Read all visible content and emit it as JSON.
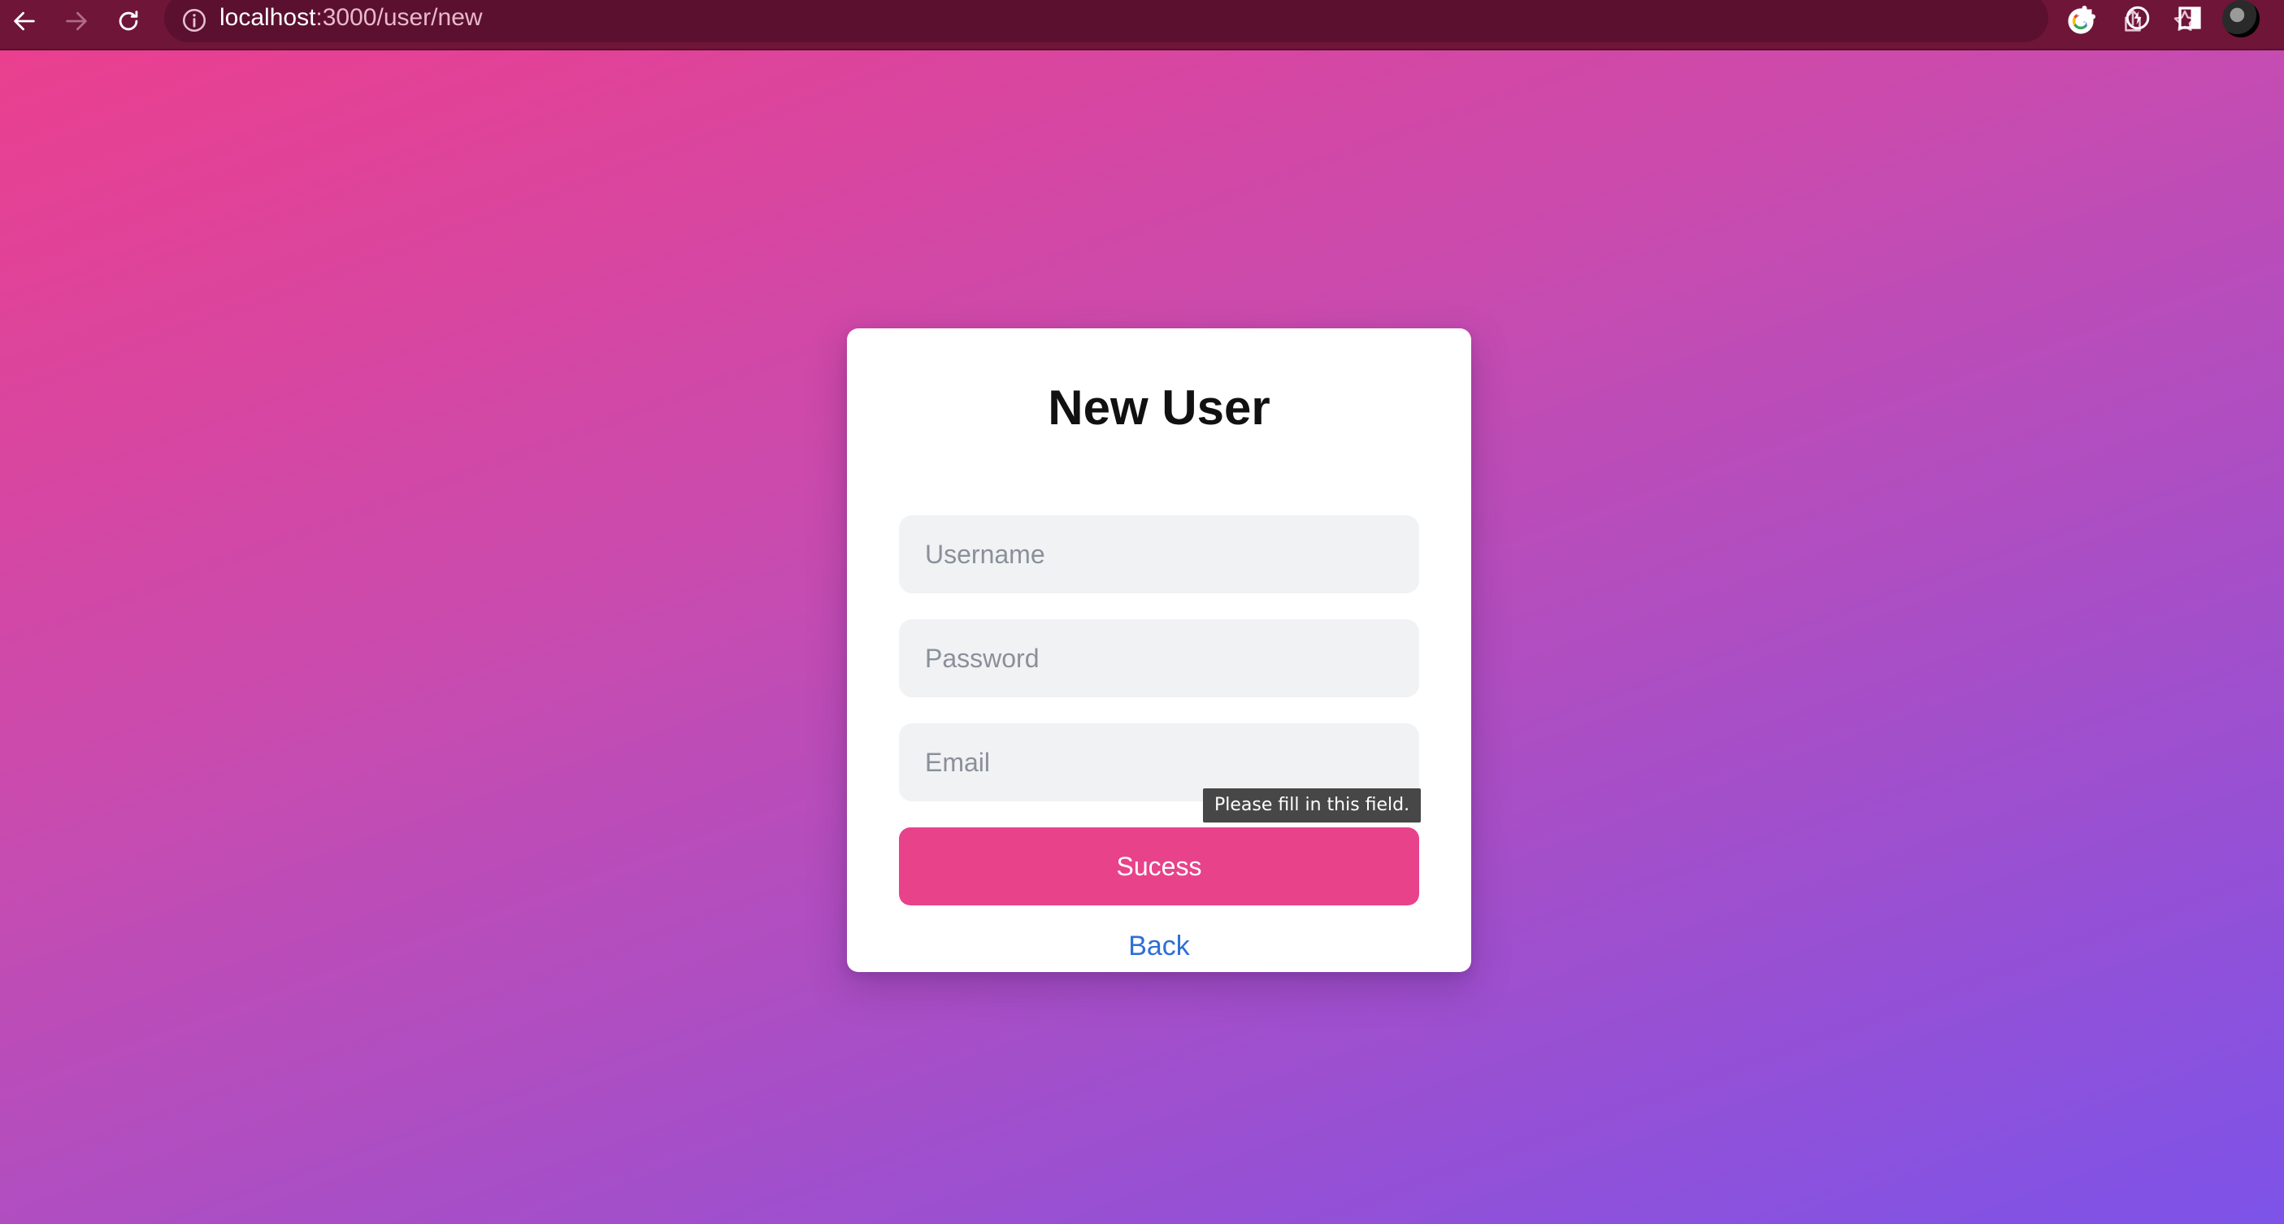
{
  "browser": {
    "url_host": "localhost",
    "url_path": ":3000/user/new",
    "theme_color": "#6f1538"
  },
  "toolbar_icons": [
    "back-arrow-icon",
    "forward-arrow-icon",
    "reload-icon",
    "info-icon",
    "google-icon",
    "share-icon",
    "star-icon",
    "extensions-icon",
    "lightning-icon",
    "side-panel-icon"
  ],
  "form": {
    "title": "New User",
    "fields": {
      "username_placeholder": "Username",
      "password_placeholder": "Password",
      "email_placeholder": "Email"
    },
    "validation_message": "Please fill in this field.",
    "submit_label": "Sucess",
    "back_label": "Back"
  },
  "colors": {
    "submit_button": "#e8428b",
    "link": "#2e6fd6",
    "field_background": "#f1f2f4",
    "gradient_start": "#ea3f8f",
    "gradient_end": "#7d53e8"
  }
}
